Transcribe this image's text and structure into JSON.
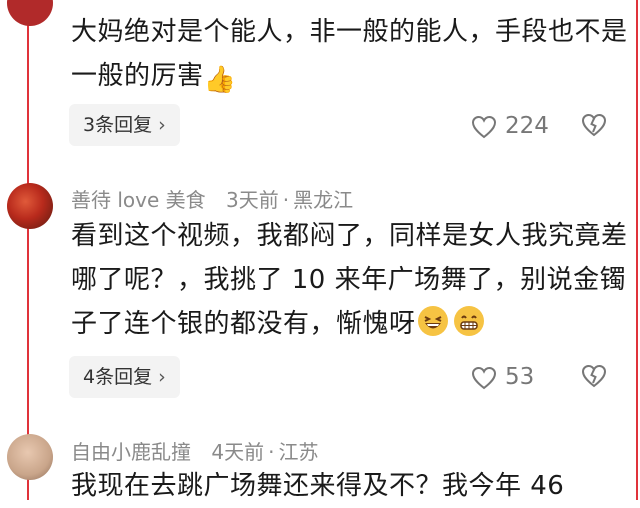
{
  "comments": [
    {
      "text": "大妈绝对是个能人，非一般的能人，手段也不是一般的厉害",
      "reply_label": "3条回复",
      "likes": "224"
    },
    {
      "username": "善待 love 美食",
      "time": "3天前",
      "location": "黑龙江",
      "text": "看到这个视频，我都闷了，同样是女人我究竟差哪了呢？，我挑了 10 来年广场舞了，别说金镯子了连个银的都没有，惭愧呀",
      "reply_label": "4条回复",
      "likes": "53"
    },
    {
      "username": "自由小鹿乱撞",
      "time": "4天前",
      "location": "江苏",
      "text": "我现在去跳广场舞还来得及不？我今年 46"
    }
  ],
  "icons": {
    "like": "heart-outline-icon",
    "dislike": "broken-heart-icon",
    "reply_chevron": "chevron-right-icon",
    "thumbs_up": "thumbs-up-emoji",
    "laugh": "grinning-squint-emoji",
    "grin": "grinning-emoji"
  },
  "colors": {
    "frame": "#e0323a",
    "meta_text": "#8a8a8a",
    "reply_bg": "#f3f3f3"
  }
}
